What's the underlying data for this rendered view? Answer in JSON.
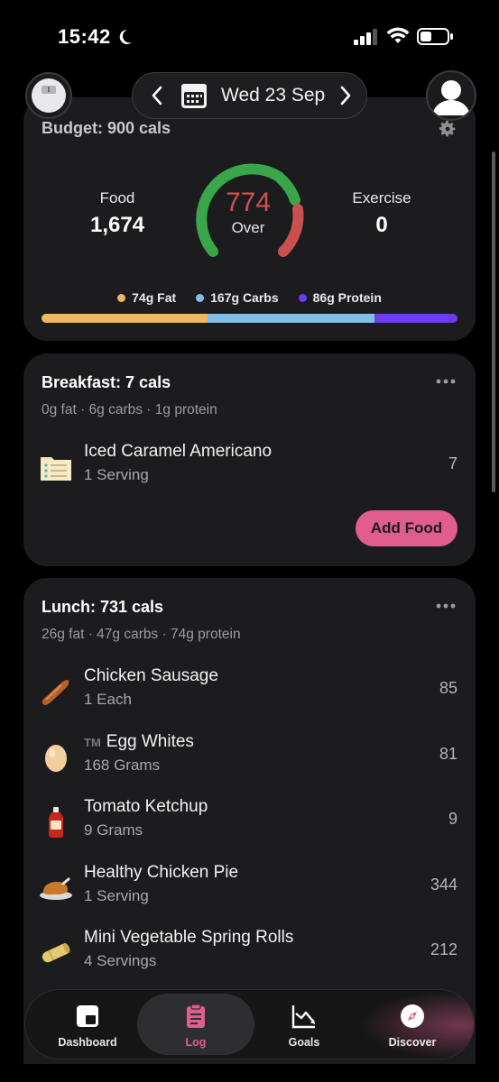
{
  "status_bar": {
    "time": "15:42"
  },
  "header": {
    "date": "Wed 23 Sep"
  },
  "budget": {
    "title": "Budget: 900 cals",
    "food_label": "Food",
    "food_value": "1,674",
    "exercise_label": "Exercise",
    "exercise_value": "0",
    "gauge_value": "774",
    "gauge_label": "Over",
    "macros": [
      {
        "label": "74g Fat",
        "color": "#f0b95b"
      },
      {
        "label": "167g Carbs",
        "color": "#7dbfe8"
      },
      {
        "label": "86g Protein",
        "color": "#6d3cf0"
      }
    ]
  },
  "breakfast": {
    "title": "Breakfast: 7 cals",
    "summary": "0g fat · 6g carbs · 1g protein",
    "items": [
      {
        "name": "Iced Caramel Americano",
        "qty": "1 Serving",
        "cals": "7",
        "icon": "generic-food-icon"
      }
    ],
    "add_food_label": "Add Food"
  },
  "lunch": {
    "title": "Lunch: 731 cals",
    "summary": "26g fat · 47g carbs · 74g protein",
    "items": [
      {
        "name": "Chicken Sausage",
        "qty": "1 Each",
        "cals": "85",
        "icon": "sausage-icon"
      },
      {
        "name": "Egg Whites",
        "tm": "TM",
        "qty": "168 Grams",
        "cals": "81",
        "icon": "egg-icon"
      },
      {
        "name": "Tomato Ketchup",
        "qty": "9 Grams",
        "cals": "9",
        "icon": "ketchup-icon"
      },
      {
        "name": "Healthy Chicken Pie",
        "qty": "1 Serving",
        "cals": "344",
        "icon": "roast-chicken-icon"
      },
      {
        "name": "Mini Vegetable Spring Rolls",
        "qty": "4 Servings",
        "cals": "212",
        "icon": "spring-roll-icon"
      }
    ]
  },
  "tabs": [
    {
      "label": "Dashboard",
      "icon": "dashboard-icon"
    },
    {
      "label": "Log",
      "icon": "clipboard-icon"
    },
    {
      "label": "Goals",
      "icon": "chart-icon"
    },
    {
      "label": "Discover",
      "icon": "compass-icon"
    }
  ],
  "colors": {
    "accent": "#e05e8c",
    "gauge_green": "#3aa64a",
    "gauge_red": "#c9504f"
  }
}
